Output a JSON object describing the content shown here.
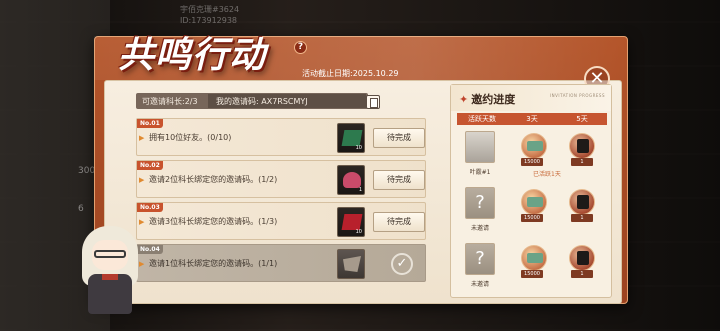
{
  "background": {
    "top_text_line1": "宇佰克珊#3624",
    "top_text_line2": "ID:173912938",
    "left_text_1": "300",
    "left_text_2": "6"
  },
  "header": {
    "title": "共鸣行动",
    "help_icon": "question-icon",
    "deadline": "活动截止日期:2025.10.29",
    "close_icon": "close-icon"
  },
  "invite_bar": {
    "limit_label": "可邀请科长:2/3",
    "code_label": "我的邀请码: AX7RSCMYJ",
    "copy_icon": "copy-icon"
  },
  "tasks": [
    {
      "no": "No.01",
      "text": "拥有10位好友。(0/10)",
      "reward_count": "10",
      "reward_color": "#2d7a4e",
      "status": "待完成",
      "done": false
    },
    {
      "no": "No.02",
      "text": "邀请2位科长绑定您的邀请码。(1/2)",
      "reward_count": "1",
      "reward_color": "#c94b6a",
      "status": "待完成",
      "done": false
    },
    {
      "no": "No.03",
      "text": "邀请3位科长绑定您的邀请码。(1/3)",
      "reward_count": "10",
      "reward_color": "#b8202c",
      "status": "待完成",
      "done": false
    },
    {
      "no": "No.04",
      "text": "邀请1位科长绑定您的邀请码。(1/1)",
      "reward_count": "",
      "reward_color": "#6a6058",
      "status": "",
      "done": true
    }
  ],
  "progress": {
    "title": "邀约进度",
    "subtitle": "INVITATION PROGRESS",
    "col_header": "活跃天数",
    "col_3": "3天",
    "col_5": "5天",
    "rows": [
      {
        "name": "叶霰#1",
        "avatar": "character-avatar",
        "reward_3": "15000",
        "reward_5": "1",
        "claimed": "已活跃1天"
      },
      {
        "name": "未邀请",
        "avatar": "question-icon",
        "reward_3": "15000",
        "reward_5": "1",
        "claimed": ""
      },
      {
        "name": "未邀请",
        "avatar": "question-icon",
        "reward_3": "15000",
        "reward_5": "1",
        "claimed": ""
      }
    ]
  },
  "colors": {
    "frame": "#b4552a",
    "accent": "#c65530",
    "panel": "#f8f0e2"
  }
}
